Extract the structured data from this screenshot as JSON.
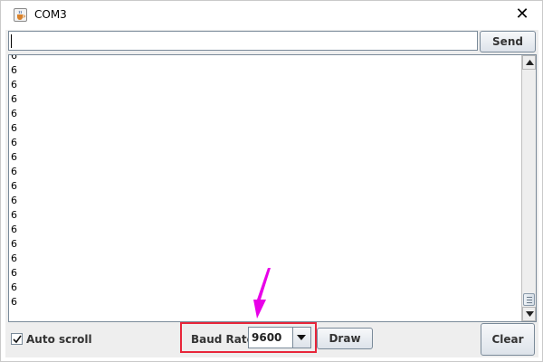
{
  "window": {
    "title": "COM3"
  },
  "send": {
    "input_value": "",
    "button_label": "Send"
  },
  "console": {
    "lines": [
      "6",
      "6",
      "6",
      "6",
      "6",
      "6",
      "6",
      "6",
      "6",
      "6",
      "6",
      "6",
      "6",
      "6",
      "6",
      "6",
      "6",
      "6"
    ]
  },
  "footer": {
    "autoscroll_label": "Auto scroll",
    "autoscroll_checked": true,
    "baud_label": "Baud Rate",
    "baud_value": "9600",
    "draw_label": "Draw",
    "clear_label": "Clear"
  },
  "colors": {
    "highlight": "#e8263a",
    "pointer": "#e800e8"
  },
  "icons": {
    "app": "java-cup-icon",
    "close": "close-icon",
    "dropdown": "chevron-down-icon"
  }
}
